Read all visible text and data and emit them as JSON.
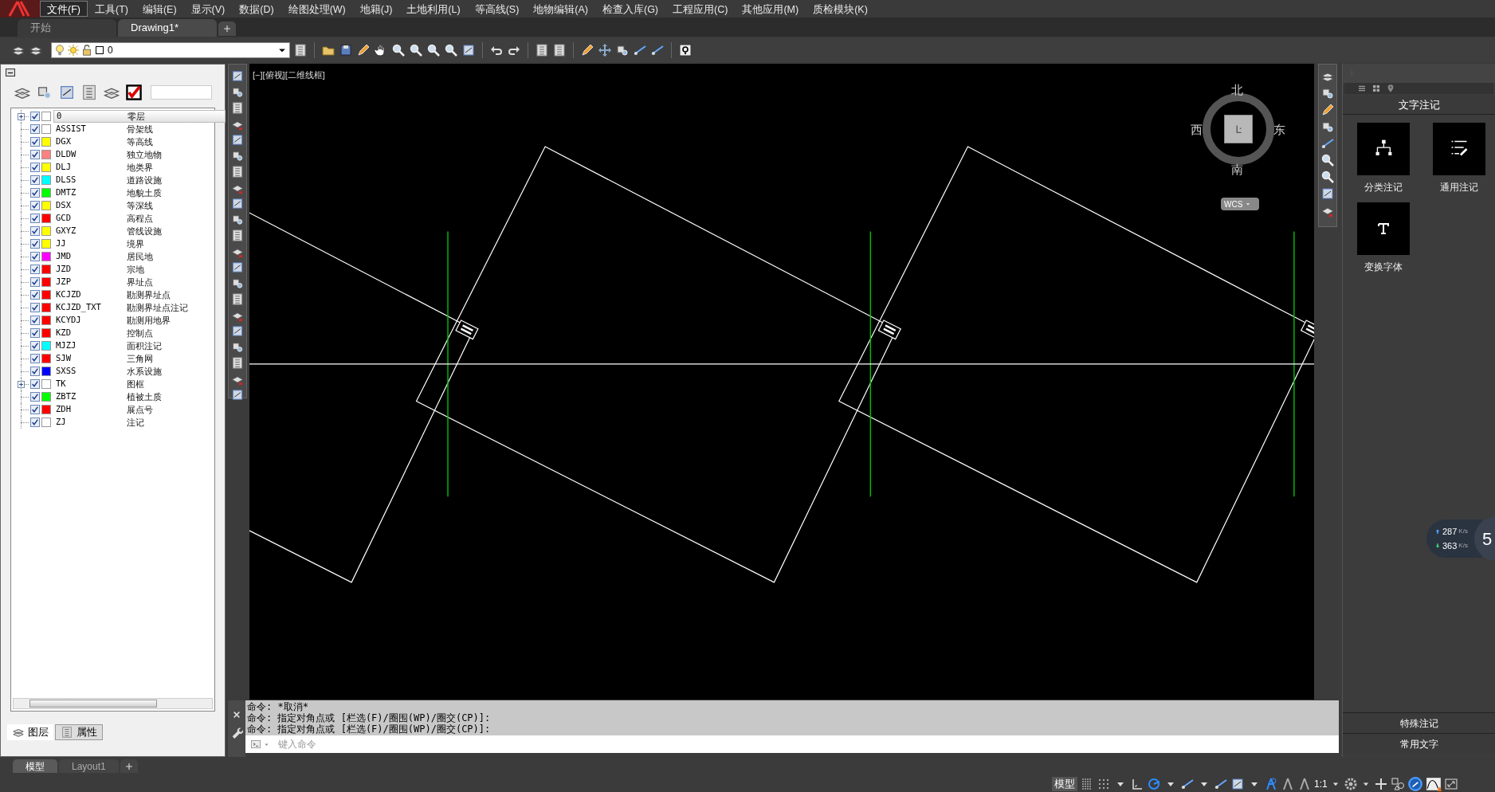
{
  "menu": [
    {
      "label": "文件(F)",
      "selected": true
    },
    {
      "label": "工具(T)",
      "selected": false
    },
    {
      "label": "编辑(E)",
      "selected": false
    },
    {
      "label": "显示(V)",
      "selected": false
    },
    {
      "label": "数据(D)",
      "selected": false
    },
    {
      "label": "绘图处理(W)",
      "selected": false
    },
    {
      "label": "地籍(J)",
      "selected": false
    },
    {
      "label": "土地利用(L)",
      "selected": false
    },
    {
      "label": "等高线(S)",
      "selected": false
    },
    {
      "label": "地物编辑(A)",
      "selected": false
    },
    {
      "label": "检查入库(G)",
      "selected": false
    },
    {
      "label": "工程应用(C)",
      "selected": false
    },
    {
      "label": "其他应用(M)",
      "selected": false
    },
    {
      "label": "质检模块(K)",
      "selected": false
    }
  ],
  "doc_tabs": [
    {
      "label": "开始",
      "selected": false
    },
    {
      "label": "Drawing1*",
      "selected": true
    }
  ],
  "layer_combo": {
    "value": "0"
  },
  "layers": [
    {
      "name": "0",
      "description": "零层",
      "visible": true,
      "color": "#ffffff",
      "expandable": true,
      "selected": true
    },
    {
      "name": "ASSIST",
      "description": "骨架线",
      "visible": true,
      "color": "#ffffff",
      "expandable": false,
      "selected": false
    },
    {
      "name": "DGX",
      "description": "等高线",
      "visible": true,
      "color": "#ffff00",
      "expandable": false,
      "selected": false
    },
    {
      "name": "DLDW",
      "description": "独立地物",
      "visible": true,
      "color": "#ff8080",
      "expandable": false,
      "selected": false
    },
    {
      "name": "DLJ",
      "description": "地类界",
      "visible": true,
      "color": "#ffff00",
      "expandable": false,
      "selected": false
    },
    {
      "name": "DLSS",
      "description": "道路设施",
      "visible": true,
      "color": "#00ffff",
      "expandable": false,
      "selected": false
    },
    {
      "name": "DMTZ",
      "description": "地貌土质",
      "visible": true,
      "color": "#00ff00",
      "expandable": false,
      "selected": false
    },
    {
      "name": "DSX",
      "description": "等深线",
      "visible": true,
      "color": "#ffff00",
      "expandable": false,
      "selected": false
    },
    {
      "name": "GCD",
      "description": "高程点",
      "visible": true,
      "color": "#ff0000",
      "expandable": false,
      "selected": false
    },
    {
      "name": "GXYZ",
      "description": "管线设施",
      "visible": true,
      "color": "#ffff00",
      "expandable": false,
      "selected": false
    },
    {
      "name": "JJ",
      "description": "境界",
      "visible": true,
      "color": "#ffff00",
      "expandable": false,
      "selected": false
    },
    {
      "name": "JMD",
      "description": "居民地",
      "visible": true,
      "color": "#ff00ff",
      "expandable": false,
      "selected": false
    },
    {
      "name": "JZD",
      "description": "宗地",
      "visible": true,
      "color": "#ff0000",
      "expandable": false,
      "selected": false
    },
    {
      "name": "JZP",
      "description": "界址点",
      "visible": true,
      "color": "#ff0000",
      "expandable": false,
      "selected": false
    },
    {
      "name": "KCJZD",
      "description": "勘测界址点",
      "visible": true,
      "color": "#ff0000",
      "expandable": false,
      "selected": false
    },
    {
      "name": "KCJZD_TXT",
      "description": "勘测界址点注记",
      "visible": true,
      "color": "#ff0000",
      "expandable": false,
      "selected": false
    },
    {
      "name": "KCYDJ",
      "description": "勘测用地界",
      "visible": true,
      "color": "#ff0000",
      "expandable": false,
      "selected": false
    },
    {
      "name": "KZD",
      "description": "控制点",
      "visible": true,
      "color": "#ff0000",
      "expandable": false,
      "selected": false
    },
    {
      "name": "MJZJ",
      "description": "面积注记",
      "visible": true,
      "color": "#00ffff",
      "expandable": false,
      "selected": false
    },
    {
      "name": "SJW",
      "description": "三角网",
      "visible": true,
      "color": "#ff0000",
      "expandable": false,
      "selected": false
    },
    {
      "name": "SXSS",
      "description": "水系设施",
      "visible": true,
      "color": "#0000ff",
      "expandable": false,
      "selected": false
    },
    {
      "name": "TK",
      "description": "图框",
      "visible": true,
      "color": "#ffffff",
      "expandable": true,
      "selected": false
    },
    {
      "name": "ZBTZ",
      "description": "植被土质",
      "visible": true,
      "color": "#00ff00",
      "expandable": false,
      "selected": false
    },
    {
      "name": "ZDH",
      "description": "展点号",
      "visible": true,
      "color": "#ff0000",
      "expandable": false,
      "selected": false
    },
    {
      "name": "ZJ",
      "description": "注记",
      "visible": true,
      "color": "#ffffff",
      "expandable": false,
      "selected": false
    }
  ],
  "panel_tabs": [
    {
      "label": "图层",
      "selected": true
    },
    {
      "label": "属性",
      "selected": false
    }
  ],
  "viewport_label": "[−][俯视][二维线框]",
  "compass": {
    "north": "北",
    "east": "东",
    "south": "南",
    "west": "西",
    "ucs": "WCS"
  },
  "command_history": [
    "命令: *取消*",
    "命令: 指定对角点或 [栏选(F)/圈围(WP)/圈交(CP)]:",
    "命令: 指定对角点或 [栏选(F)/圈围(WP)/圈交(CP)]:"
  ],
  "command_input": {
    "placeholder": "键入命令"
  },
  "layout_tabs": [
    {
      "label": "模型",
      "selected": true
    },
    {
      "label": "Layout1",
      "selected": false
    }
  ],
  "right_panel": {
    "title": "文字注记",
    "tools": [
      {
        "label": "分类注记",
        "kind": "tree"
      },
      {
        "label": "通用注记",
        "kind": "list"
      },
      {
        "label": "变换字体",
        "kind": "font"
      }
    ],
    "sections": [
      "特殊注记",
      "常用文字"
    ]
  },
  "net_speed": {
    "up": "287",
    "up_unit": "K/s",
    "down": "363",
    "down_unit": "K/s",
    "badge": "5"
  },
  "status_bar": {
    "model": "模型",
    "scale": "1:1"
  }
}
